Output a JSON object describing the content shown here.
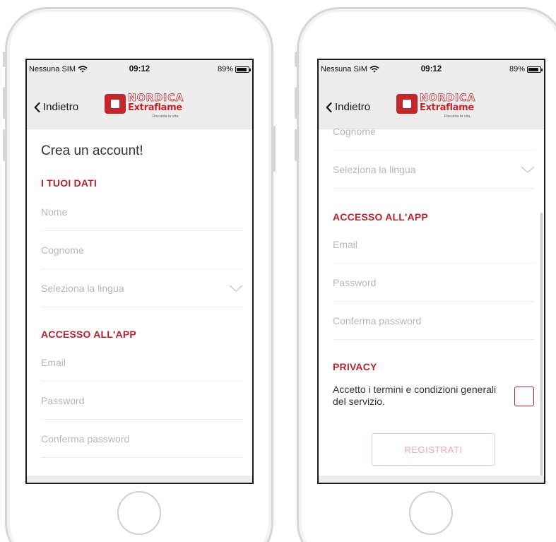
{
  "status_bar": {
    "carrier": "Nessuna SIM",
    "time": "09:12",
    "battery": "89%",
    "battery_level": 0.89
  },
  "nav": {
    "back_label": "Indietro",
    "logo_top": "NORDICA",
    "logo_bottom": "Extraflame",
    "logo_tagline": "Riscalda la vita."
  },
  "form": {
    "title": "Crea un account!",
    "section_personal": "I TUOI DATI",
    "first_name_placeholder": "Nome",
    "last_name_placeholder": "Cognome",
    "language_placeholder": "Seleziona la lingua",
    "section_access": "ACCESSO ALL'APP",
    "email_placeholder": "Email",
    "password_placeholder": "Password",
    "confirm_password_placeholder": "Conferma password",
    "section_privacy": "PRIVACY",
    "consent_text": "Accetto i termini e condizioni generali del servizio.",
    "consent_checked": false,
    "register_label": "REGISTRATI"
  },
  "colors": {
    "accent": "#b3242e",
    "placeholder": "#b8b8b8",
    "bar_background": "#ededed",
    "button_disabled_border": "#f0c6ca"
  },
  "icons": {
    "back": "chevron-left-icon",
    "select": "chevron-down-icon",
    "wifi": "wifi-icon",
    "battery": "battery-icon"
  }
}
